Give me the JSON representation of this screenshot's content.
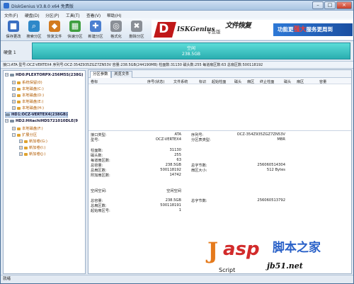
{
  "window": {
    "title": "DiskGenius V3.8.0 x64 免费版",
    "buttons": {
      "minimize": "–",
      "maximize": "□",
      "close": "×"
    }
  },
  "menu": [
    "文件(F)",
    "硬盘(D)",
    "分区(P)",
    "工具(T)",
    "查看(V)",
    "帮助(H)"
  ],
  "toolbar": [
    {
      "label": "保存更改",
      "icon": "save-icon",
      "color": "#3a6fc2",
      "glyph": "■"
    },
    {
      "label": "搜索分区",
      "icon": "search-icon",
      "color": "#2e88c9",
      "glyph": "⌕"
    },
    {
      "label": "恢复文件",
      "icon": "recover-file-icon",
      "color": "#d27a1f",
      "glyph": "◆"
    },
    {
      "label": "快速分区",
      "icon": "quick-partition-icon",
      "color": "#3f9e3f",
      "glyph": "▦"
    },
    {
      "label": "新建分区",
      "icon": "new-partition-icon",
      "color": "#4b7fd0",
      "glyph": "✚"
    },
    {
      "label": "格式化",
      "icon": "format-icon",
      "color": "#8a8f96",
      "glyph": "◎"
    },
    {
      "label": "删除分区",
      "icon": "delete-partition-icon",
      "color": "#8a8f96",
      "glyph": "✖"
    },
    {
      "label": "备份分区",
      "icon": "backup-partition-icon",
      "color": "#8a8f96",
      "glyph": "▤"
    }
  ],
  "banner": {
    "logo_letter": "D",
    "brand": "ISKGenius",
    "edition": "专业版",
    "slogan": "文件恢复",
    "promo_pre": "功能更",
    "promo_strong": "强大",
    "promo_post": "服务更周到"
  },
  "disk_strip": {
    "label": "硬盘 1",
    "partition_label": "空闲",
    "partition_size": "238.5GB"
  },
  "info_bar": "接口:ATA  型号:OCZ-VERTEX4  序列号:OCZ-354Z935ZGZ7ZN53V  容量:238.5GB(244190MB)  柱面数:31130  磁头数:255  每道扇区数:63  总扇区数:500118192",
  "tree": [
    {
      "label": "HD0:PLEXTORPX-256M5S(238G)",
      "kind": "disk",
      "level": 0,
      "toggle": "-",
      "bold": true,
      "selected": false,
      "accent": false
    },
    {
      "label": "系统保留(0)",
      "kind": "part",
      "level": 1,
      "toggle": "+",
      "bold": false,
      "selected": false,
      "accent": true
    },
    {
      "label": "本地磁盘(C:)",
      "kind": "part",
      "level": 1,
      "toggle": "+",
      "bold": false,
      "selected": false,
      "accent": true
    },
    {
      "label": "本地磁盘(D:)",
      "kind": "part",
      "level": 1,
      "toggle": "+",
      "bold": false,
      "selected": false,
      "accent": true
    },
    {
      "label": "本地磁盘(E:)",
      "kind": "part",
      "level": 1,
      "toggle": "+",
      "bold": false,
      "selected": false,
      "accent": true
    },
    {
      "label": "本地磁盘(H:)",
      "kind": "part",
      "level": 1,
      "toggle": "+",
      "bold": false,
      "selected": false,
      "accent": true
    },
    {
      "label": "HD1:OCZ-VERTEX4(238GB)",
      "kind": "disk",
      "level": 0,
      "toggle": "",
      "bold": true,
      "selected": true,
      "accent": false
    },
    {
      "label": "HD2:HitachiHDS721010DLE(9",
      "kind": "disk",
      "level": 0,
      "toggle": "-",
      "bold": true,
      "selected": false,
      "accent": false
    },
    {
      "label": "本地磁盘(F:)",
      "kind": "part",
      "level": 1,
      "toggle": "+",
      "bold": false,
      "selected": false,
      "accent": true
    },
    {
      "label": "扩展分区",
      "kind": "part",
      "level": 1,
      "toggle": "-",
      "bold": false,
      "selected": false,
      "accent": true
    },
    {
      "label": "新加卷(G:)",
      "kind": "part",
      "level": 2,
      "toggle": "+",
      "bold": false,
      "selected": false,
      "accent": true
    },
    {
      "label": "新加卷(I:)",
      "kind": "part",
      "level": 2,
      "toggle": "+",
      "bold": false,
      "selected": false,
      "accent": true
    },
    {
      "label": "新加卷(J:)",
      "kind": "part",
      "level": 2,
      "toggle": "+",
      "bold": false,
      "selected": false,
      "accent": true
    }
  ],
  "tabs": [
    "分区参数",
    "浏览文件"
  ],
  "columns": [
    "卷标",
    "序号(状态)",
    "文件系统",
    "标识",
    "起始柱面",
    "磁头",
    "扇区",
    "终止柱面",
    "磁头",
    "扇区",
    "容量"
  ],
  "details": {
    "interface_type_label": "接口类型:",
    "interface_type": "ATA",
    "serial_label": "序列号:",
    "serial": "OCZ-354Z935ZGZ7ZN53V",
    "model_label": "型号:",
    "model": "OCZ-VERTEX4",
    "table_type_label": "分区表类型:",
    "table_type": "MBR",
    "cylinders_label": "柱面数:",
    "cylinders": "31130",
    "heads_label": "磁头数:",
    "heads": "255",
    "sectors_per_track_label": "每道扇区数:",
    "sectors_per_track": "63",
    "capacity_label": "总容量:",
    "capacity": "238.5GB",
    "total_bytes_label": "总字节数:",
    "total_bytes": "256060514304",
    "total_sectors_label": "总扇区数:",
    "total_sectors": "500118192",
    "sector_size_label": "扇区大小:",
    "sector_size": "512 Bytes",
    "extra_sectors_label": "附加扇区数:",
    "extra_sectors": "14742",
    "free_space_label": "空闲空间:",
    "free_space": "空闲空间",
    "free_capacity_label": "总容量:",
    "free_capacity": "238.5GB",
    "free_bytes_label": "总字节数:",
    "free_bytes": "256060513792",
    "free_sectors_label": "总扇区数:",
    "free_sectors": "500118191",
    "start_sector_label": "起始扇区号:",
    "start_sector": "1"
  },
  "status": "就绪",
  "watermark": {
    "j": "J",
    "asp": "asp",
    "cn": "脚本之家",
    "script": "Script",
    "url": "jb51.net"
  }
}
